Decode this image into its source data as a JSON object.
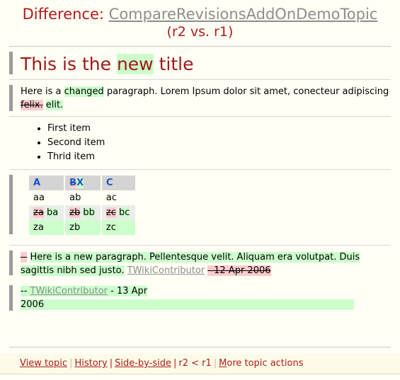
{
  "header": {
    "prefix": "Difference:",
    "topic": "CompareRevisionsAddOnDemoTopic",
    "revisions": "(r2 vs. r1)"
  },
  "colors": {
    "page_background": "#fffff5",
    "heading_red": "#a01818",
    "header_red": "#b01b1b",
    "link_gray": "#8e8e8e",
    "inserted_green": "#ccffcc",
    "deleted_pink": "#ffcccc",
    "change_bar_gray": "#9b9b9b",
    "table_header_gray": "#d4d4d4",
    "table_mixed_gray": "#ececec",
    "table_header_text_blue": "#1757c4",
    "footer_background": "#fdfbe8"
  },
  "title_block": {
    "text_before": "This is the ",
    "inserted": "new",
    "text_after": " title"
  },
  "paragraph_block": {
    "text_1": "Here is a ",
    "inserted_1": "changed",
    "text_2": " paragraph. Lorem Ipsum dolor sit amet, conecteur adipiscing ",
    "deleted_1": "felix.",
    "space": " ",
    "inserted_2": "elit."
  },
  "list_block": {
    "items": [
      "First item",
      "Second item",
      "Thrid item"
    ]
  },
  "table_block": {
    "header": {
      "col_a": "A",
      "col_b_deleted": "B",
      "col_b_inserted": "X",
      "col_c": "C"
    },
    "rows": [
      {
        "type": "plain",
        "cells": [
          {
            "plain": "aa"
          },
          {
            "plain": "ab"
          },
          {
            "plain": "ac"
          }
        ]
      },
      {
        "type": "mixed",
        "cells": [
          {
            "deleted": "za",
            "inserted": "ba"
          },
          {
            "deleted": "zb",
            "inserted": "bb"
          },
          {
            "deleted": "zc",
            "inserted": "bc"
          }
        ]
      },
      {
        "type": "added",
        "cells": [
          {
            "inserted": "za"
          },
          {
            "inserted": "zb"
          },
          {
            "inserted": "zc"
          }
        ]
      }
    ]
  },
  "new_paragraph_block": {
    "deleted_dash": "--",
    "inserted_text": "Here is a new paragraph. Pellentesque velit. Aliquam era volutpat. Duis sagittis nibh sed justo.",
    "signature_link": "TWikiContributor",
    "deleted_date": "- 12 Apr 2006"
  },
  "signature_block": {
    "dashes": "--",
    "link": "TWikiContributor",
    "separator": " - ",
    "date": "13 Apr 2006"
  },
  "footer": {
    "view_topic": {
      "accesskey": "V",
      "rest": "iew topic"
    },
    "history": {
      "accesskey": "H",
      "rest": "istory"
    },
    "side_by_side": {
      "accesskey": "S",
      "rest": "ide-by-side"
    },
    "revision_compare": "r2 < r1",
    "more_actions": {
      "accesskey": "M",
      "rest": "ore topic actions"
    },
    "separator": "|"
  }
}
